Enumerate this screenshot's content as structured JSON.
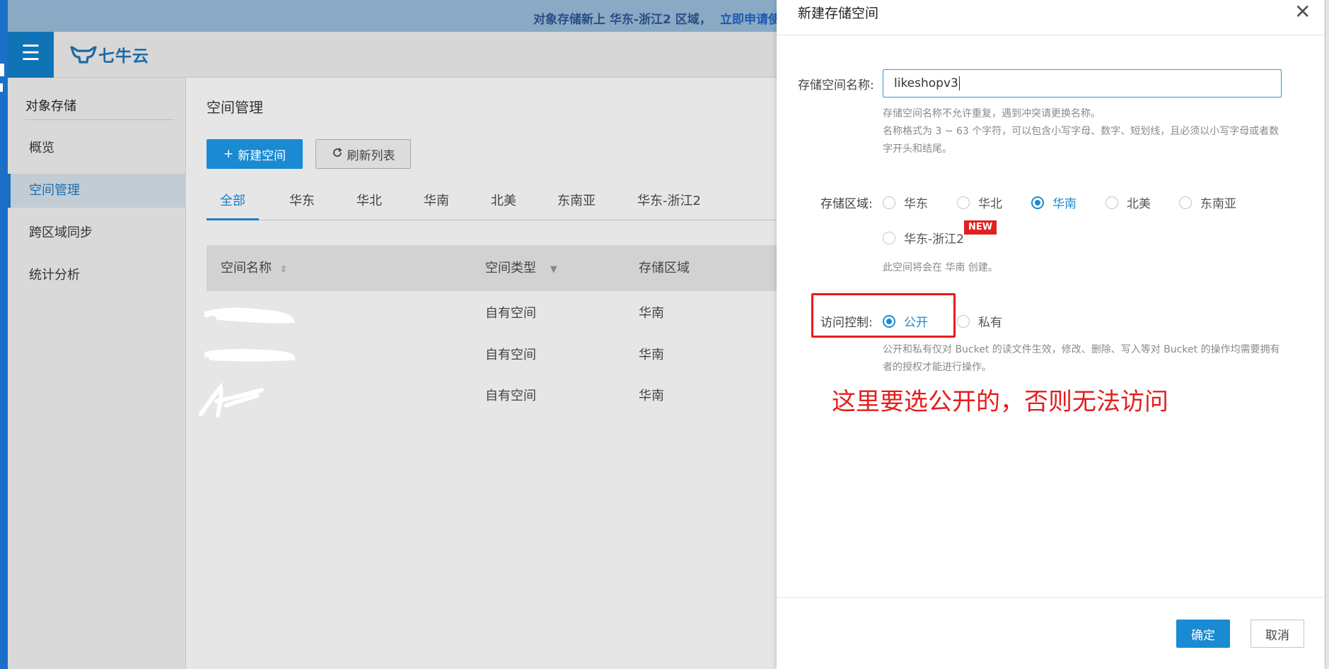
{
  "banner": {
    "text": "对象存储新上 华东-浙江2 区域，",
    "link": "立即申请使"
  },
  "topbar": {
    "menu_icon": "hamburger-icon",
    "logo_text": "七牛云",
    "logo_icon": "qiniu-logo-icon"
  },
  "sidebar": {
    "title": "对象存储",
    "items": [
      {
        "label": "概览"
      },
      {
        "label": "空间管理"
      },
      {
        "label": "跨区域同步"
      },
      {
        "label": "统计分析"
      }
    ]
  },
  "main": {
    "heading": "空间管理",
    "new_button": "新建空间",
    "refresh_button": "刷新列表",
    "tabs": [
      "全部",
      "华东",
      "华北",
      "华南",
      "北美",
      "东南亚",
      "华东-浙江2"
    ],
    "columns": [
      "空间名称",
      "空间类型",
      "存储区域"
    ],
    "rows": [
      {
        "type": "自有空间",
        "region": "华南"
      },
      {
        "type": "自有空间",
        "region": "华南"
      },
      {
        "type": "自有空间",
        "region": "华南"
      }
    ]
  },
  "drawer": {
    "title": "新建存储空间",
    "name_label": "存储空间名称:",
    "name_value": "likeshopv3",
    "name_hint_1": "存储空间名称不允许重复，遇到冲突请更换名称。",
    "name_hint_2": "名称格式为 3 ~ 63 个字符，可以包含小写字母、数字、短划线，且必须以小写字母或者数字开头和结尾。",
    "region_label": "存储区域:",
    "regions": [
      "华东",
      "华北",
      "华南",
      "北美",
      "东南亚",
      "华东-浙江2"
    ],
    "region_selected": "华南",
    "new_badge": "NEW",
    "region_hint": "此空间将会在 华南 创建。",
    "access_label": "访问控制:",
    "access_options": [
      "公开",
      "私有"
    ],
    "access_selected": "公开",
    "access_hint": "公开和私有仅对 Bucket 的读文件生效，修改、删除、写入等对 Bucket 的操作均需要拥有者的授权才能进行操作。",
    "annotation": "这里要选公开的，否则无法访问",
    "ok_button": "确定",
    "cancel_button": "取消"
  },
  "colors": {
    "accent": "#1a8ad2",
    "annotation": "#e41e1e"
  }
}
